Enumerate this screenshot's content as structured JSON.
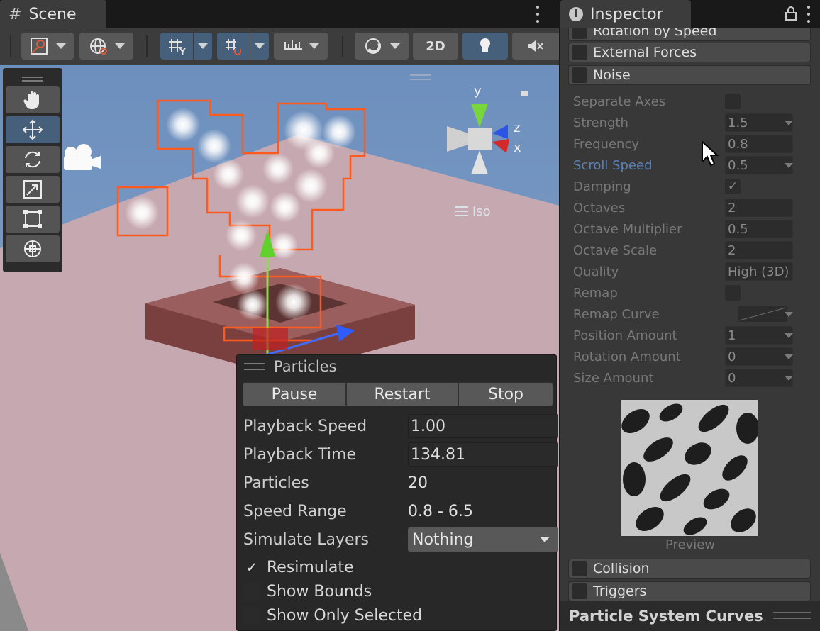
{
  "scene": {
    "tab_title": "Scene",
    "toolbar": {
      "mode_2d_label": "2D"
    },
    "gizmo": {
      "y_label": "y",
      "z_label": "z",
      "x_label": "x",
      "projection_label": "Iso"
    }
  },
  "particles_overlay": {
    "title": "Particles",
    "buttons": {
      "pause": "Pause",
      "restart": "Restart",
      "stop": "Stop"
    },
    "playback_speed": {
      "label": "Playback Speed",
      "value": "1.00"
    },
    "playback_time": {
      "label": "Playback Time",
      "value": "134.81"
    },
    "particles": {
      "label": "Particles",
      "value": "20"
    },
    "speed_range": {
      "label": "Speed Range",
      "value": "0.8 - 6.5"
    },
    "simulate_layers": {
      "label": "Simulate Layers",
      "value": "Nothing"
    },
    "resimulate": {
      "label": "Resimulate",
      "checked": true
    },
    "show_bounds": {
      "label": "Show Bounds",
      "checked": false
    },
    "show_only_selected": {
      "label": "Show Only Selected",
      "checked": false
    }
  },
  "inspector": {
    "tab_title": "Inspector",
    "modules_top": [
      "Rotation by Speed",
      "External Forces",
      "Noise"
    ],
    "noise_props": [
      {
        "label": "Separate Axes",
        "kind": "checkbox",
        "value": ""
      },
      {
        "label": "Strength",
        "kind": "curve",
        "value": "1.5"
      },
      {
        "label": "Frequency",
        "kind": "field",
        "value": "0.8"
      },
      {
        "label": "Scroll Speed",
        "kind": "curve",
        "value": "0.5",
        "highlight": true
      },
      {
        "label": "Damping",
        "kind": "checkbox",
        "value": "✓"
      },
      {
        "label": "Octaves",
        "kind": "field",
        "value": "2"
      },
      {
        "label": "Octave Multiplier",
        "kind": "field",
        "value": "0.5"
      },
      {
        "label": "Octave Scale",
        "kind": "field",
        "value": "2"
      },
      {
        "label": "Quality",
        "kind": "field",
        "value": "High (3D)"
      },
      {
        "label": "Remap",
        "kind": "checkbox",
        "value": ""
      },
      {
        "label": "Remap Curve",
        "kind": "curvegraph",
        "value": ""
      },
      {
        "label": "Position Amount",
        "kind": "curve",
        "value": "1"
      },
      {
        "label": "Rotation Amount",
        "kind": "curve",
        "value": "0"
      },
      {
        "label": "Size Amount",
        "kind": "curve",
        "value": "0"
      }
    ],
    "preview_label": "Preview",
    "modules_bottom": [
      "Collision",
      "Triggers"
    ],
    "footer_title": "Particle System Curves"
  }
}
